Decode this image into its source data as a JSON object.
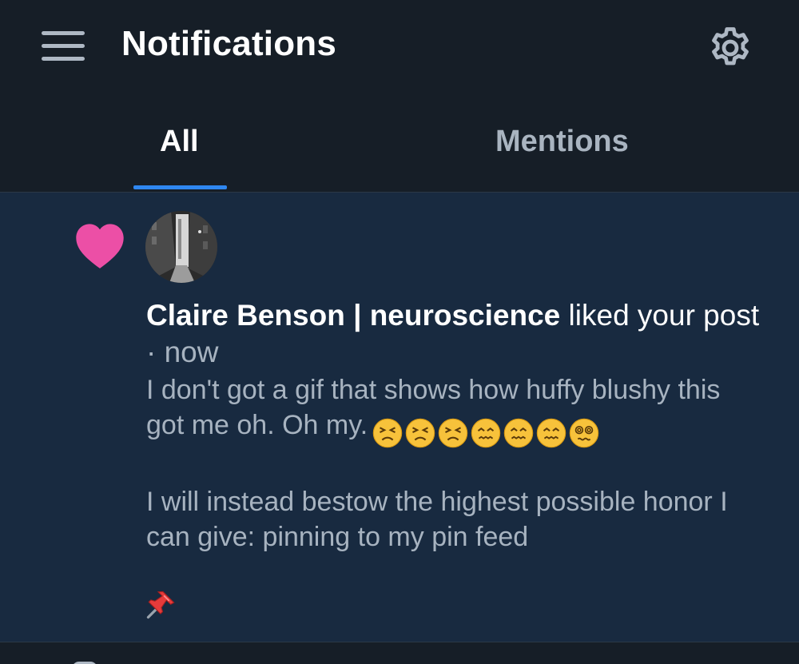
{
  "header": {
    "title": "Notifications",
    "menu_icon": "hamburger-menu-icon",
    "settings_icon": "gear-icon"
  },
  "tabs": [
    {
      "label": "All",
      "active": true
    },
    {
      "label": "Mentions",
      "active": false
    }
  ],
  "notification": {
    "type_icon": "heart-icon",
    "type_color": "#ec4fa6",
    "author": "Claire Benson | neuroscience",
    "action": " liked your post",
    "separator": " · ",
    "time": "now",
    "post_line1": "I don't got a gif that shows how huffy blushy this got me oh. Oh my.",
    "emojis": [
      "😣",
      "😣",
      "😣",
      "😖",
      "😖",
      "😖",
      "😵‍💫"
    ],
    "post_paragraph2": "I will instead bestow the highest possible honor I can give: pinning to my pin feed",
    "post_emoji_end": "📌"
  },
  "colors": {
    "background": "#161e27",
    "highlight_bg": "#182a40",
    "accent": "#2f87f0",
    "muted_text": "#a7b3c0"
  }
}
